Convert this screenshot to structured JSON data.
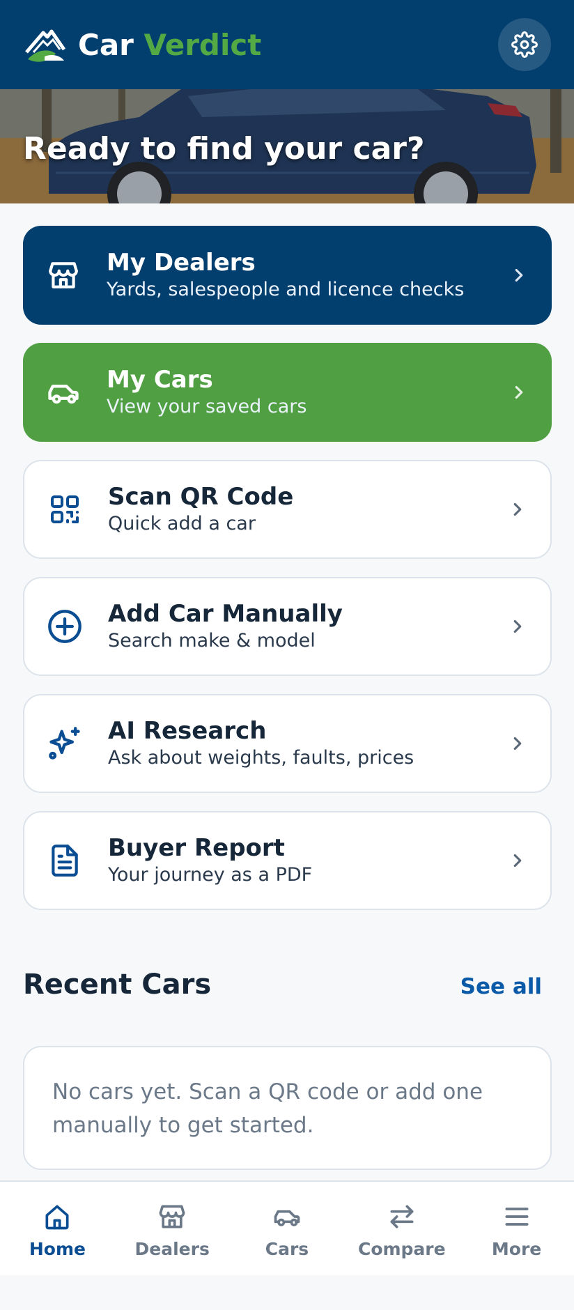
{
  "header": {
    "brand_part1": "Car",
    "brand_part2": "Verdict",
    "logo_icon": "mountain-logo-icon",
    "settings_icon": "gear-icon"
  },
  "hero": {
    "title": "Ready to find your car?"
  },
  "cards": [
    {
      "title": "My Dealers",
      "subtitle": "Yards, salespeople and licence checks",
      "icon": "storefront-icon",
      "style": "navy"
    },
    {
      "title": "My Cars",
      "subtitle": "View your saved cars",
      "icon": "car-icon",
      "style": "green"
    },
    {
      "title": "Scan QR Code",
      "subtitle": "Quick add a car",
      "icon": "qr-code-icon",
      "style": "light"
    },
    {
      "title": "Add Car Manually",
      "subtitle": "Search make & model",
      "icon": "plus-circle-icon",
      "style": "light"
    },
    {
      "title": "AI Research",
      "subtitle": "Ask about weights, faults, prices",
      "icon": "sparkle-icon",
      "style": "light"
    },
    {
      "title": "Buyer Report",
      "subtitle": "Your journey as a PDF",
      "icon": "document-icon",
      "style": "light"
    }
  ],
  "recent": {
    "title": "Recent Cars",
    "see_all": "See all",
    "empty_text": "No cars yet. Scan a QR code or add one manually to get started."
  },
  "bottom_nav": [
    {
      "label": "Home",
      "icon": "home-icon",
      "active": true
    },
    {
      "label": "Dealers",
      "icon": "storefront-icon",
      "active": false
    },
    {
      "label": "Cars",
      "icon": "car-icon",
      "active": false
    },
    {
      "label": "Compare",
      "icon": "arrows-swap-icon",
      "active": false
    },
    {
      "label": "More",
      "icon": "menu-icon",
      "active": false
    }
  ],
  "colors": {
    "navy": "#033f6e",
    "green": "#50a043",
    "brand_green": "#53a944",
    "link_blue": "#0a5aa8",
    "icon_blue": "#0a4d92",
    "muted": "#6a7888"
  }
}
